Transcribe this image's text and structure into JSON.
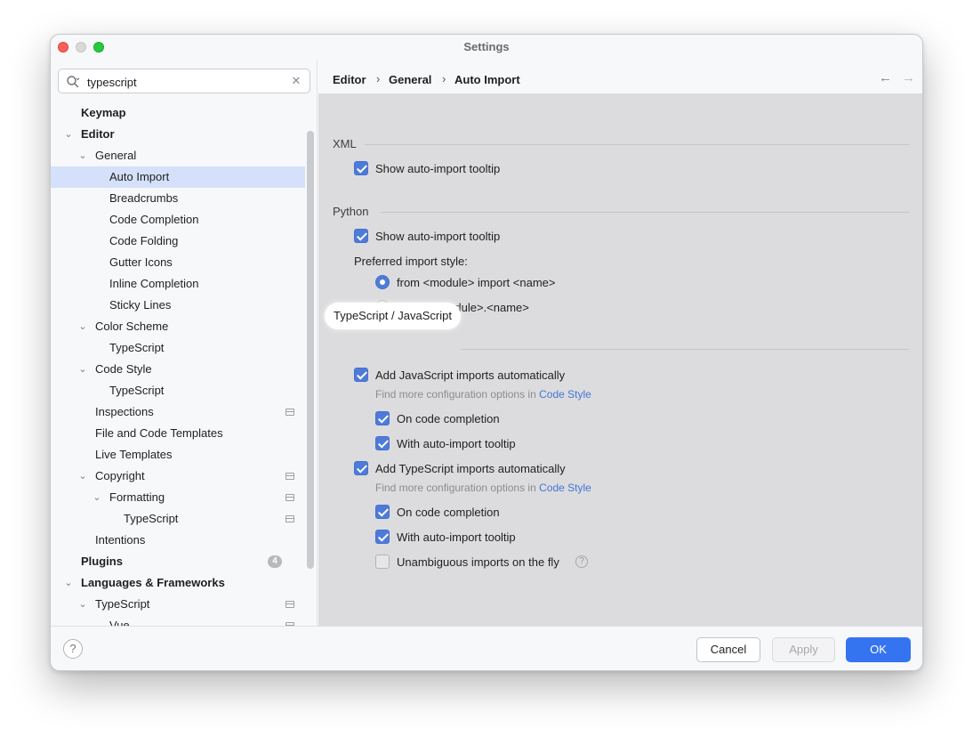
{
  "window": {
    "title": "Settings"
  },
  "search": {
    "value": "typescript"
  },
  "tree": [
    {
      "label": "Keymap",
      "bold": true,
      "chevron": "",
      "project": false
    },
    {
      "label": "Editor",
      "bold": true,
      "chevron": "down",
      "project": false
    },
    {
      "label": "General",
      "bold": false,
      "chevron": "down",
      "project": false
    },
    {
      "label": "Auto Import",
      "bold": false,
      "chevron": "",
      "project": false,
      "selected": true
    },
    {
      "label": "Breadcrumbs",
      "bold": false,
      "chevron": "",
      "project": false
    },
    {
      "label": "Code Completion",
      "bold": false,
      "chevron": "",
      "project": false
    },
    {
      "label": "Code Folding",
      "bold": false,
      "chevron": "",
      "project": false
    },
    {
      "label": "Gutter Icons",
      "bold": false,
      "chevron": "",
      "project": false
    },
    {
      "label": "Inline Completion",
      "bold": false,
      "chevron": "",
      "project": false
    },
    {
      "label": "Sticky Lines",
      "bold": false,
      "chevron": "",
      "project": false
    },
    {
      "label": "Color Scheme",
      "bold": false,
      "chevron": "down",
      "project": false
    },
    {
      "label": "TypeScript",
      "bold": false,
      "chevron": "",
      "project": false
    },
    {
      "label": "Code Style",
      "bold": false,
      "chevron": "down",
      "project": false
    },
    {
      "label": "TypeScript",
      "bold": false,
      "chevron": "",
      "project": false
    },
    {
      "label": "Inspections",
      "bold": false,
      "chevron": "",
      "project": true
    },
    {
      "label": "File and Code Templates",
      "bold": false,
      "chevron": "",
      "project": false
    },
    {
      "label": "Live Templates",
      "bold": false,
      "chevron": "",
      "project": false
    },
    {
      "label": "Copyright",
      "bold": false,
      "chevron": "down",
      "project": true
    },
    {
      "label": "Formatting",
      "bold": false,
      "chevron": "down",
      "project": true
    },
    {
      "label": "TypeScript",
      "bold": false,
      "chevron": "",
      "project": true
    },
    {
      "label": "Intentions",
      "bold": false,
      "chevron": "",
      "project": false
    },
    {
      "label": "Plugins",
      "bold": true,
      "chevron": "",
      "project": false,
      "badge": "4"
    },
    {
      "label": "Languages & Frameworks",
      "bold": true,
      "chevron": "down",
      "project": false
    },
    {
      "label": "TypeScript",
      "bold": false,
      "chevron": "down",
      "project": true
    },
    {
      "label": "Vue",
      "bold": false,
      "chevron": "",
      "project": true
    }
  ],
  "breadcrumb": {
    "items": [
      "Editor",
      "General",
      "Auto Import"
    ],
    "separator": "›"
  },
  "nav": {
    "back": "←",
    "forward": "→"
  },
  "xml": {
    "title": "XML",
    "show_tooltip": {
      "label": "Show auto-import tooltip",
      "checked": true
    }
  },
  "python": {
    "title": "Python",
    "show_tooltip": {
      "label": "Show auto-import tooltip",
      "checked": true
    },
    "style_label": "Preferred import style:",
    "options": [
      {
        "label": "from <module> import <name>",
        "selected": true
      },
      {
        "label": "import <module>.<name>",
        "selected": false
      }
    ]
  },
  "ts": {
    "title": "TypeScript / JavaScript",
    "js_auto": {
      "label": "Add JavaScript imports automatically",
      "checked": true
    },
    "js_hint": "Find more configuration options in ",
    "js_hint_link": "Code Style",
    "js_completion": {
      "label": "On code completion",
      "checked": true
    },
    "js_tooltip": {
      "label": "With auto-import tooltip",
      "checked": true
    },
    "ts_auto": {
      "label": "Add TypeScript imports automatically",
      "checked": true
    },
    "ts_hint": "Find more configuration options in ",
    "ts_hint_link": "Code Style",
    "ts_completion": {
      "label": "On code completion",
      "checked": true
    },
    "ts_tooltip": {
      "label": "With auto-import tooltip",
      "checked": true
    },
    "ts_fly": {
      "label": "Unambiguous imports on the fly",
      "checked": false
    }
  },
  "footer": {
    "help": "?",
    "cancel": "Cancel",
    "apply": "Apply",
    "ok": "OK"
  },
  "colors": {
    "accent": "#3574f0",
    "checkbox": "#4f7bd8",
    "selection": "#d5e1fa",
    "link": "#4474d6"
  }
}
